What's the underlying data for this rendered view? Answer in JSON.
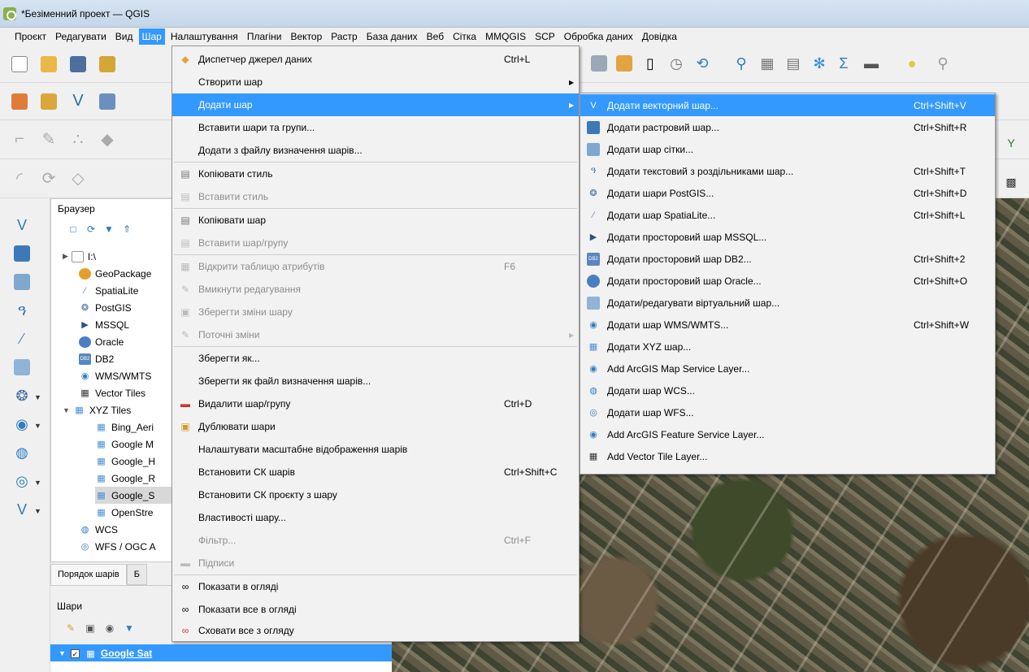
{
  "window": {
    "title": "*Безіменний проект — QGIS"
  },
  "menubar": [
    "Проєкт",
    "Редагувати",
    "Вид",
    "Шар",
    "Налаштування",
    "Плагіни",
    "Вектор",
    "Растр",
    "База даних",
    "Веб",
    "Сітка",
    "MMQGIS",
    "SCP",
    "Обробка даних",
    "Довідка"
  ],
  "browser": {
    "title": "Браузер",
    "items": [
      "I:\\",
      "GeoPackage",
      "SpatiaLite",
      "PostGIS",
      "MSSQL",
      "Oracle",
      "DB2",
      "WMS/WMTS",
      "Vector Tiles",
      "XYZ Tiles",
      "Bing_Aeri",
      "Google M",
      "Google_H",
      "Google_R",
      "Google_S",
      "OpenStre",
      "WCS",
      "WFS / OGC A"
    ]
  },
  "tabs": [
    "Порядок шарів",
    "Б"
  ],
  "layers": {
    "title": "Шари",
    "layer_name": "Google Sat"
  },
  "layer_menu": {
    "items": [
      {
        "label": "Диспетчер джерел даних",
        "shortcut": "Ctrl+L"
      },
      {
        "label": "Створити шар"
      },
      {
        "label": "Додати шар"
      },
      {
        "label": "Вставити шари та групи..."
      },
      {
        "label": "Додати з файлу визначення шарів..."
      },
      {
        "label": "Копіювати стиль"
      },
      {
        "label": "Вставити стиль"
      },
      {
        "label": "Копіювати шар"
      },
      {
        "label": "Вставити шар/групу"
      },
      {
        "label": "Відкрити таблицю атрибутів",
        "shortcut": "F6"
      },
      {
        "label": "Вмикнути редагування"
      },
      {
        "label": "Зберегти зміни шару"
      },
      {
        "label": "Поточні зміни"
      },
      {
        "label": "Зберегти як..."
      },
      {
        "label": "Зберегти як файл визначення шарів..."
      },
      {
        "label": "Видалити шар/групу",
        "shortcut": "Ctrl+D"
      },
      {
        "label": "Дублювати шари"
      },
      {
        "label": "Налаштувати масштабне відображення шарів"
      },
      {
        "label": "Встановити СК шарів",
        "shortcut": "Ctrl+Shift+C"
      },
      {
        "label": "Встановити СК проєкту з шару"
      },
      {
        "label": "Властивості шару..."
      },
      {
        "label": "Фільтр...",
        "shortcut": "Ctrl+F"
      },
      {
        "label": "Підписи"
      },
      {
        "label": "Показати в огляді"
      },
      {
        "label": "Показати все в огляді"
      },
      {
        "label": "Сховати все з огляду"
      }
    ]
  },
  "add_layer_submenu": {
    "items": [
      {
        "label": "Додати векторний шар...",
        "shortcut": "Ctrl+Shift+V"
      },
      {
        "label": "Додати растровий шар...",
        "shortcut": "Ctrl+Shift+R"
      },
      {
        "label": "Додати шар сітки..."
      },
      {
        "label": "Додати текстовий з роздільниками шар...",
        "shortcut": "Ctrl+Shift+T"
      },
      {
        "label": "Додати шари PostGIS...",
        "shortcut": "Ctrl+Shift+D"
      },
      {
        "label": "Додати шар SpatiaLite...",
        "shortcut": "Ctrl+Shift+L"
      },
      {
        "label": "Додати просторовий шар MSSQL..."
      },
      {
        "label": "Додати просторовий шар DB2...",
        "shortcut": "Ctrl+Shift+2"
      },
      {
        "label": "Додати просторовий шар Oracle...",
        "shortcut": "Ctrl+Shift+O"
      },
      {
        "label": "Додати/редагувати віртуальний шар..."
      },
      {
        "label": "Додати шар WMS/WMTS...",
        "shortcut": "Ctrl+Shift+W"
      },
      {
        "label": "Додати XYZ шар..."
      },
      {
        "label": "Add ArcGIS Map Service Layer..."
      },
      {
        "label": "Додати шар WCS..."
      },
      {
        "label": "Додати шар WFS..."
      },
      {
        "label": "Add ArcGIS Feature Service Layer..."
      },
      {
        "label": "Add Vector Tile Layer..."
      }
    ]
  },
  "colors": {
    "highlight": "#3399ff",
    "menu_bg": "#f2f2f2",
    "disabled": "#8d8d8d"
  }
}
